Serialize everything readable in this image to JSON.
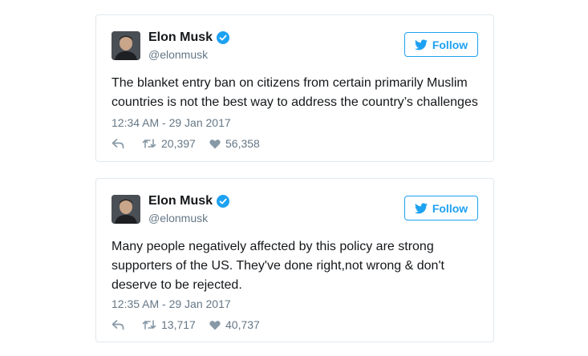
{
  "tweets": [
    {
      "display_name": "Elon Musk",
      "handle": "@elonmusk",
      "follow_label": "Follow",
      "text": "The blanket entry ban on citizens from certain primarily Muslim countries is not the best way to address the country’s challenges",
      "timestamp": "12:34 AM - 29 Jan 2017",
      "retweets": "20,397",
      "likes": "56,358"
    },
    {
      "display_name": "Elon Musk",
      "handle": "@elonmusk",
      "follow_label": "Follow",
      "text": "Many people negatively affected by this policy are strong supporters of the US. They've done right,not wrong & don't deserve to be rejected.",
      "timestamp": "12:35 AM - 29 Jan 2017",
      "retweets": "13,717",
      "likes": "40,737"
    }
  ],
  "colors": {
    "accent": "#1da1f2",
    "muted": "#657786",
    "border": "#e1e8ed",
    "text": "#14171a"
  },
  "icons": {
    "verified": "verified-badge-icon",
    "follow": "twitter-bird-icon",
    "reply": "reply-icon",
    "retweet": "retweet-icon",
    "like": "heart-icon"
  }
}
